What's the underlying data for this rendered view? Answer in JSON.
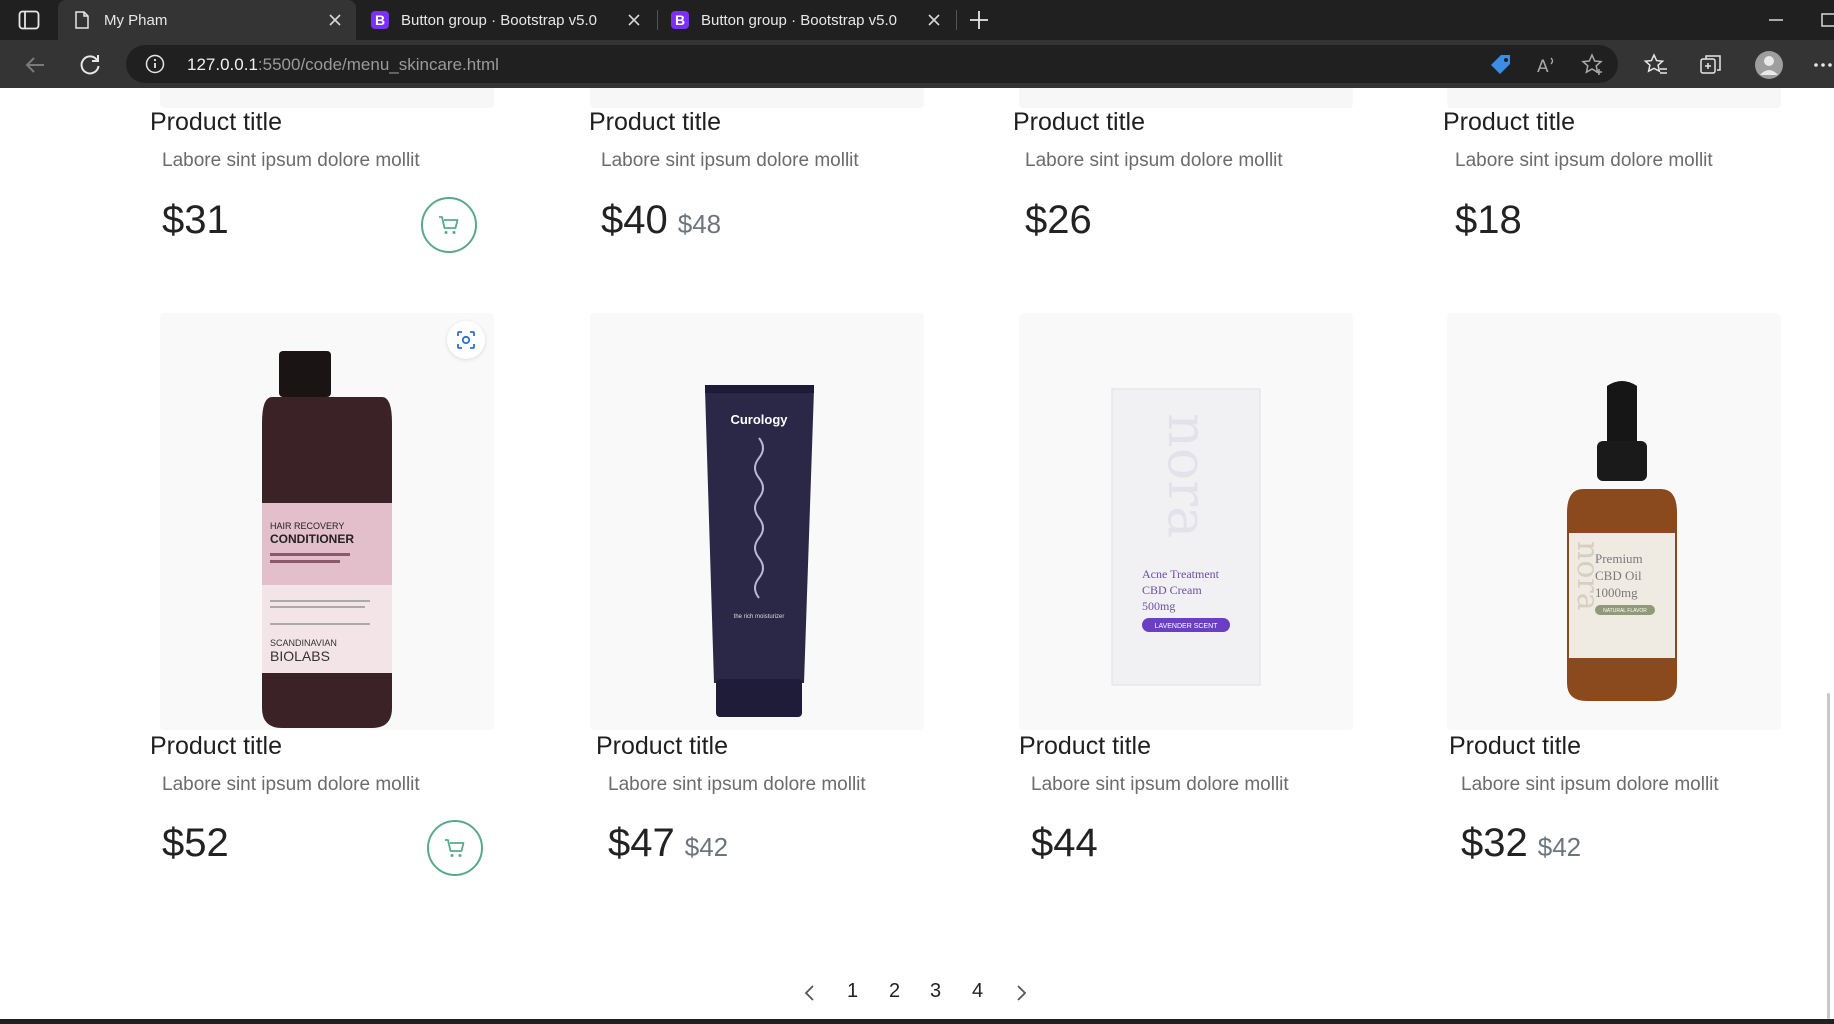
{
  "browser": {
    "tabs": [
      {
        "title": "My Pham",
        "favicon": "document-icon",
        "active": true
      },
      {
        "title": "Button group · Bootstrap v5.0",
        "favicon": "bootstrap-icon",
        "active": false
      },
      {
        "title": "Button group · Bootstrap v5.0",
        "favicon": "bootstrap-icon",
        "active": false
      }
    ],
    "url": {
      "host": "127.0.0.1",
      "rest": ":5500/code/menu_skincare.html"
    },
    "bootstrap_letter": "B"
  },
  "products_top": [
    {
      "title": "Product title",
      "desc": "Labore sint ipsum dolore mollit",
      "price": "$31",
      "old_price": "",
      "cart": true
    },
    {
      "title": "Product title",
      "desc": "Labore sint ipsum dolore mollit",
      "price": "$40",
      "old_price": "$48",
      "cart": false
    },
    {
      "title": "Product title",
      "desc": "Labore sint ipsum dolore mollit",
      "price": "$26",
      "old_price": "",
      "cart": false
    },
    {
      "title": "Product title",
      "desc": "Labore sint ipsum dolore mollit",
      "price": "$18",
      "old_price": "",
      "cart": false
    }
  ],
  "products_bottom": [
    {
      "title": "Product title",
      "desc": "Labore sint ipsum dolore mollit",
      "price": "$52",
      "old_price": "",
      "cart": true,
      "image": "conditioner-bottle",
      "label": {
        "line1": "HAIR RECOVERY",
        "line2": "CONDITIONER",
        "brand1": "SCANDINAVIAN",
        "brand2": "BIOLABS"
      }
    },
    {
      "title": "Product title",
      "desc": "Labore sint ipsum dolore mollit",
      "price": "$47",
      "old_price": "$42",
      "cart": false,
      "image": "moisturizer-tube",
      "label": {
        "brand": "Curology",
        "small": "the rich moisturizer"
      }
    },
    {
      "title": "Product title",
      "desc": "Labore sint ipsum dolore mollit",
      "price": "$44",
      "old_price": "",
      "cart": false,
      "image": "cream-box",
      "label": {
        "brand": "nora",
        "line1": "Acne Treatment",
        "line2": "CBD Cream",
        "line3": "500mg",
        "tag": "LAVENDER SCENT"
      }
    },
    {
      "title": "Product title",
      "desc": "Labore sint ipsum dolore mollit",
      "price": "$32",
      "old_price": "$42",
      "cart": false,
      "image": "oil-dropper",
      "label": {
        "brand": "nora",
        "line1": "Premium",
        "line2": "CBD Oil",
        "line3": "1000mg",
        "tag": "NATURAL FLAVOR"
      }
    }
  ],
  "pagination": {
    "pages": [
      "1",
      "2",
      "3",
      "4"
    ],
    "prev": "chevron-left-icon",
    "next": "chevron-right-icon"
  },
  "colors": {
    "accent": "#5aa98a",
    "chrome_dark": "#202020",
    "chrome_mid": "#343434"
  }
}
